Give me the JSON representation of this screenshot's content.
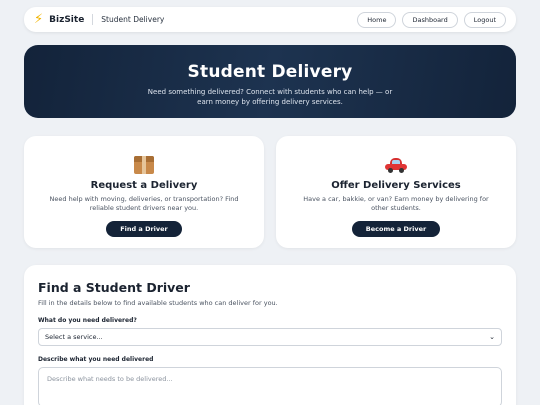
{
  "header": {
    "brand": "BizSite",
    "breadcrumb": "Student Delivery",
    "nav": [
      "Home",
      "Dashboard",
      "Logout"
    ]
  },
  "hero": {
    "title": "Student Delivery",
    "subtitle": "Need something delivered? Connect with students who can help — or earn money by offering delivery services."
  },
  "cards": [
    {
      "icon": "package-icon",
      "title": "Request a Delivery",
      "description": "Need help with moving, deliveries, or transportation? Find reliable student drivers near you.",
      "button": "Find a Driver"
    },
    {
      "icon": "car-icon",
      "title": "Offer Delivery Services",
      "description": "Have a car, bakkie, or van? Earn money by delivering for other students.",
      "button": "Become a Driver"
    }
  ],
  "form": {
    "title": "Find a Student Driver",
    "subtitle": "Fill in the details below to find available students who can deliver for you.",
    "service_label": "What do you need delivered?",
    "service_value": "Select a service...",
    "description_label": "Describe what you need delivered",
    "description_placeholder": "Describe what needs to be delivered..."
  },
  "colors": {
    "background": "#eef1f5",
    "hero": "#13233a",
    "button": "#142338",
    "brand_icon": "#f2b400"
  }
}
